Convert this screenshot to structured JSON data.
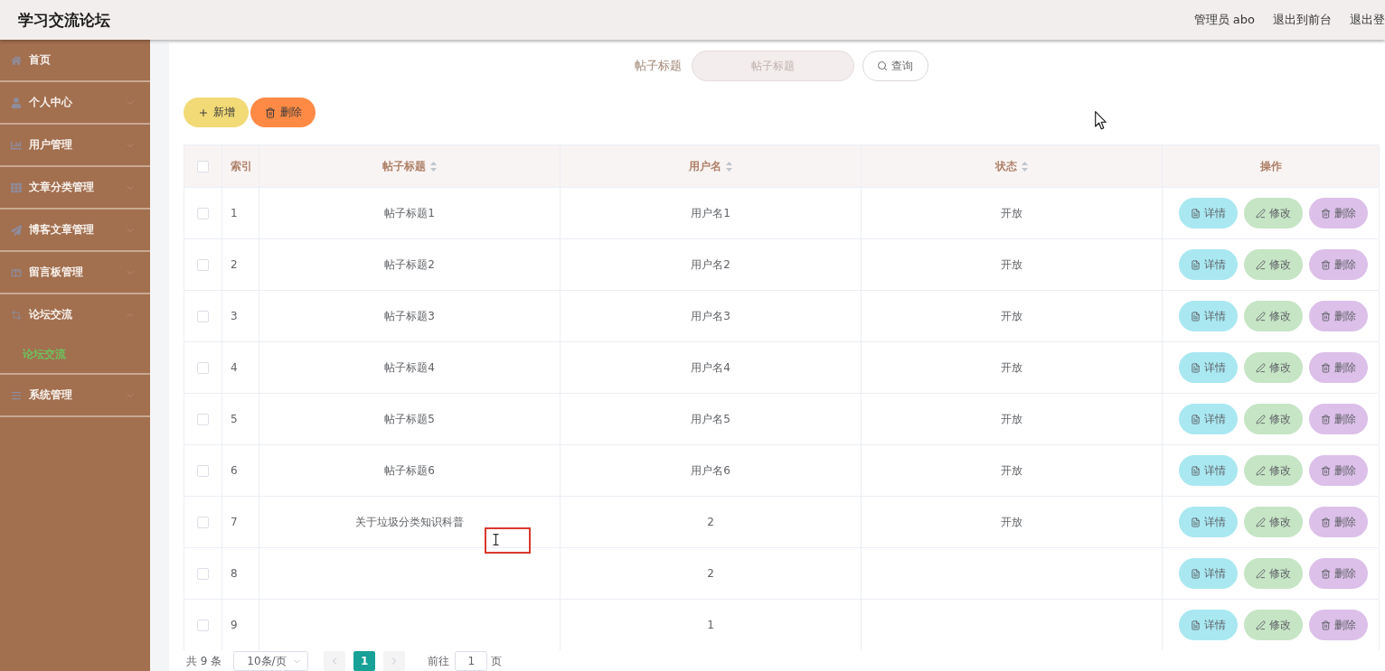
{
  "header": {
    "title": "学习交流论坛",
    "links": [
      "管理员 abo",
      "退出到前台",
      "退出登"
    ]
  },
  "sidebar": {
    "items": [
      {
        "label": "首页",
        "kind": "link"
      },
      {
        "label": "个人中心",
        "kind": "menu",
        "expanded": false
      },
      {
        "label": "用户管理",
        "kind": "menu",
        "expanded": false
      },
      {
        "label": "文章分类管理",
        "kind": "menu",
        "expanded": false
      },
      {
        "label": "博客文章管理",
        "kind": "menu",
        "expanded": false
      },
      {
        "label": "留言板管理",
        "kind": "menu",
        "expanded": false
      },
      {
        "label": "论坛交流",
        "kind": "menu",
        "expanded": true,
        "children": [
          {
            "label": "论坛交流",
            "selected": true
          }
        ]
      },
      {
        "label": "系统管理",
        "kind": "menu",
        "expanded": false
      }
    ]
  },
  "search": {
    "label": "帖子标题",
    "placeholder": "帖子标题",
    "button": "查询"
  },
  "toolbar": {
    "buttons": [
      {
        "kind": "add",
        "label": "新增"
      },
      {
        "kind": "delete",
        "label": "删除"
      }
    ]
  },
  "table": {
    "select_all": {
      "checked": false
    },
    "columns": [
      {
        "label": "索引",
        "sortable": false
      },
      {
        "label": "帖子标题",
        "sortable": true
      },
      {
        "label": "用户名",
        "sortable": true
      },
      {
        "label": "状态",
        "sortable": true
      },
      {
        "label": "操作",
        "sortable": false
      }
    ],
    "rows": [
      {
        "checked": false,
        "index": "1",
        "title": "帖子标题1",
        "user": "用户名1",
        "status": "开放",
        "actions": [
          {
            "kind": "detail",
            "label": "详情"
          },
          {
            "kind": "edit",
            "label": "修改"
          },
          {
            "kind": "delete",
            "label": "删除"
          }
        ]
      },
      {
        "checked": false,
        "index": "2",
        "title": "帖子标题2",
        "user": "用户名2",
        "status": "开放",
        "actions": [
          {
            "kind": "detail",
            "label": "详情"
          },
          {
            "kind": "edit",
            "label": "修改"
          },
          {
            "kind": "delete",
            "label": "删除"
          }
        ]
      },
      {
        "checked": false,
        "index": "3",
        "title": "帖子标题3",
        "user": "用户名3",
        "status": "开放",
        "actions": [
          {
            "kind": "detail",
            "label": "详情"
          },
          {
            "kind": "edit",
            "label": "修改"
          },
          {
            "kind": "delete",
            "label": "删除"
          }
        ]
      },
      {
        "checked": false,
        "index": "4",
        "title": "帖子标题4",
        "user": "用户名4",
        "status": "开放",
        "actions": [
          {
            "kind": "detail",
            "label": "详情"
          },
          {
            "kind": "edit",
            "label": "修改"
          },
          {
            "kind": "delete",
            "label": "删除"
          }
        ]
      },
      {
        "checked": false,
        "index": "5",
        "title": "帖子标题5",
        "user": "用户名5",
        "status": "开放",
        "actions": [
          {
            "kind": "detail",
            "label": "详情"
          },
          {
            "kind": "edit",
            "label": "修改"
          },
          {
            "kind": "delete",
            "label": "删除"
          }
        ]
      },
      {
        "checked": false,
        "index": "6",
        "title": "帖子标题6",
        "user": "用户名6",
        "status": "开放",
        "actions": [
          {
            "kind": "detail",
            "label": "详情"
          },
          {
            "kind": "edit",
            "label": "修改"
          },
          {
            "kind": "delete",
            "label": "删除"
          }
        ]
      },
      {
        "checked": false,
        "index": "7",
        "title": "关于垃圾分类知识科普",
        "user": "2",
        "status": "开放",
        "actions": [
          {
            "kind": "detail",
            "label": "详情"
          },
          {
            "kind": "edit",
            "label": "修改"
          },
          {
            "kind": "delete",
            "label": "删除"
          }
        ]
      },
      {
        "checked": false,
        "index": "8",
        "user": "2",
        "actions": [
          {
            "kind": "detail",
            "label": "详情"
          },
          {
            "kind": "edit",
            "label": "修改"
          },
          {
            "kind": "delete",
            "label": "删除"
          }
        ]
      },
      {
        "checked": false,
        "index": "9",
        "user": "1",
        "actions": [
          {
            "kind": "detail",
            "label": "详情"
          },
          {
            "kind": "edit",
            "label": "修改"
          },
          {
            "kind": "delete",
            "label": "删除"
          }
        ]
      }
    ]
  },
  "pagination": {
    "total": "共 9 条",
    "page_size": "10条/页",
    "prev": {
      "disabled": true
    },
    "pages": [
      {
        "label": "1",
        "selected": true
      }
    ],
    "next": {
      "disabled": true
    },
    "jump_label": "前往",
    "jump_value": "1",
    "jump_suffix": "页"
  }
}
